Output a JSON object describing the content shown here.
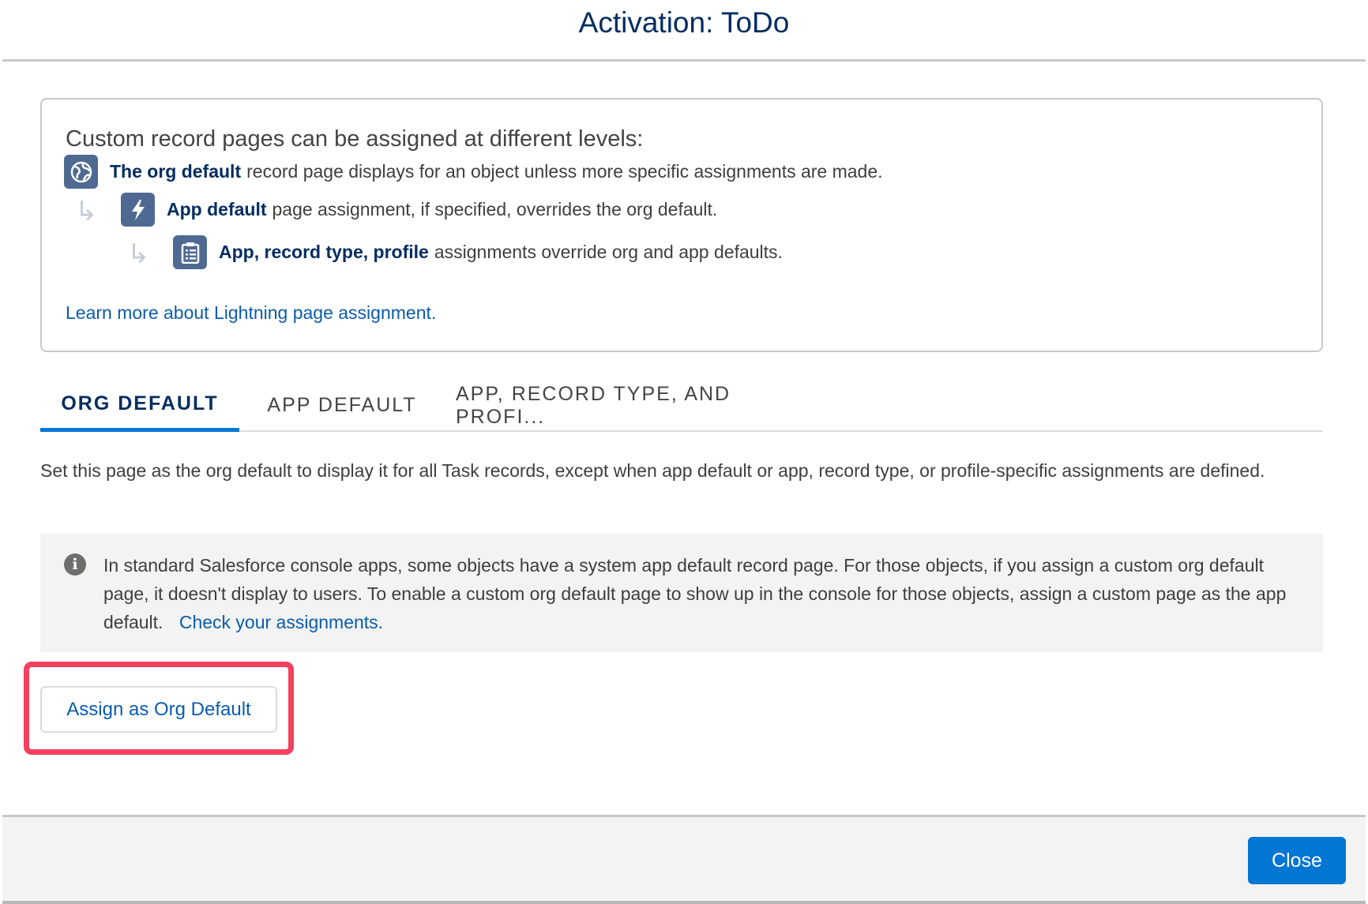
{
  "modal": {
    "title": "Activation: ToDo"
  },
  "info_card": {
    "heading": "Custom record pages can be assigned at different levels:",
    "levels": [
      {
        "icon": "globe-icon",
        "bold": "The org default",
        "text": "record page displays for an object unless more specific assignments are made."
      },
      {
        "icon": "lightning-icon",
        "bold": "App default",
        "text": "page assignment, if specified, overrides the org default."
      },
      {
        "icon": "clipboard-icon",
        "bold": "App, record type, profile",
        "text": "assignments override org and app defaults."
      }
    ],
    "link_text": "Learn more about Lightning page assignment."
  },
  "tabs": [
    {
      "label": "ORG DEFAULT",
      "active": true
    },
    {
      "label": "APP DEFAULT",
      "active": false
    },
    {
      "label": "APP, RECORD TYPE, AND PROFI...",
      "active": false
    }
  ],
  "description": "Set this page as the org default to display it for all Task records, except when app default or app, record type, or profile-specific assignments are defined.",
  "notice": {
    "icon": "info-icon",
    "text": "In standard Salesforce console apps, some objects have a system app default record page. For those objects, if you assign a custom org default page, it doesn't display to users. To enable a custom org default page to show up in the console for those objects, assign a custom page as the app default.",
    "link_text": "Check your assignments."
  },
  "actions": {
    "assign_label": "Assign as Org Default",
    "close_label": "Close"
  },
  "colors": {
    "brand": "#0176d3",
    "title": "#032d60",
    "link": "#0b5cab",
    "highlight": "#f2405e",
    "icon_bg": "#4f6a92"
  }
}
